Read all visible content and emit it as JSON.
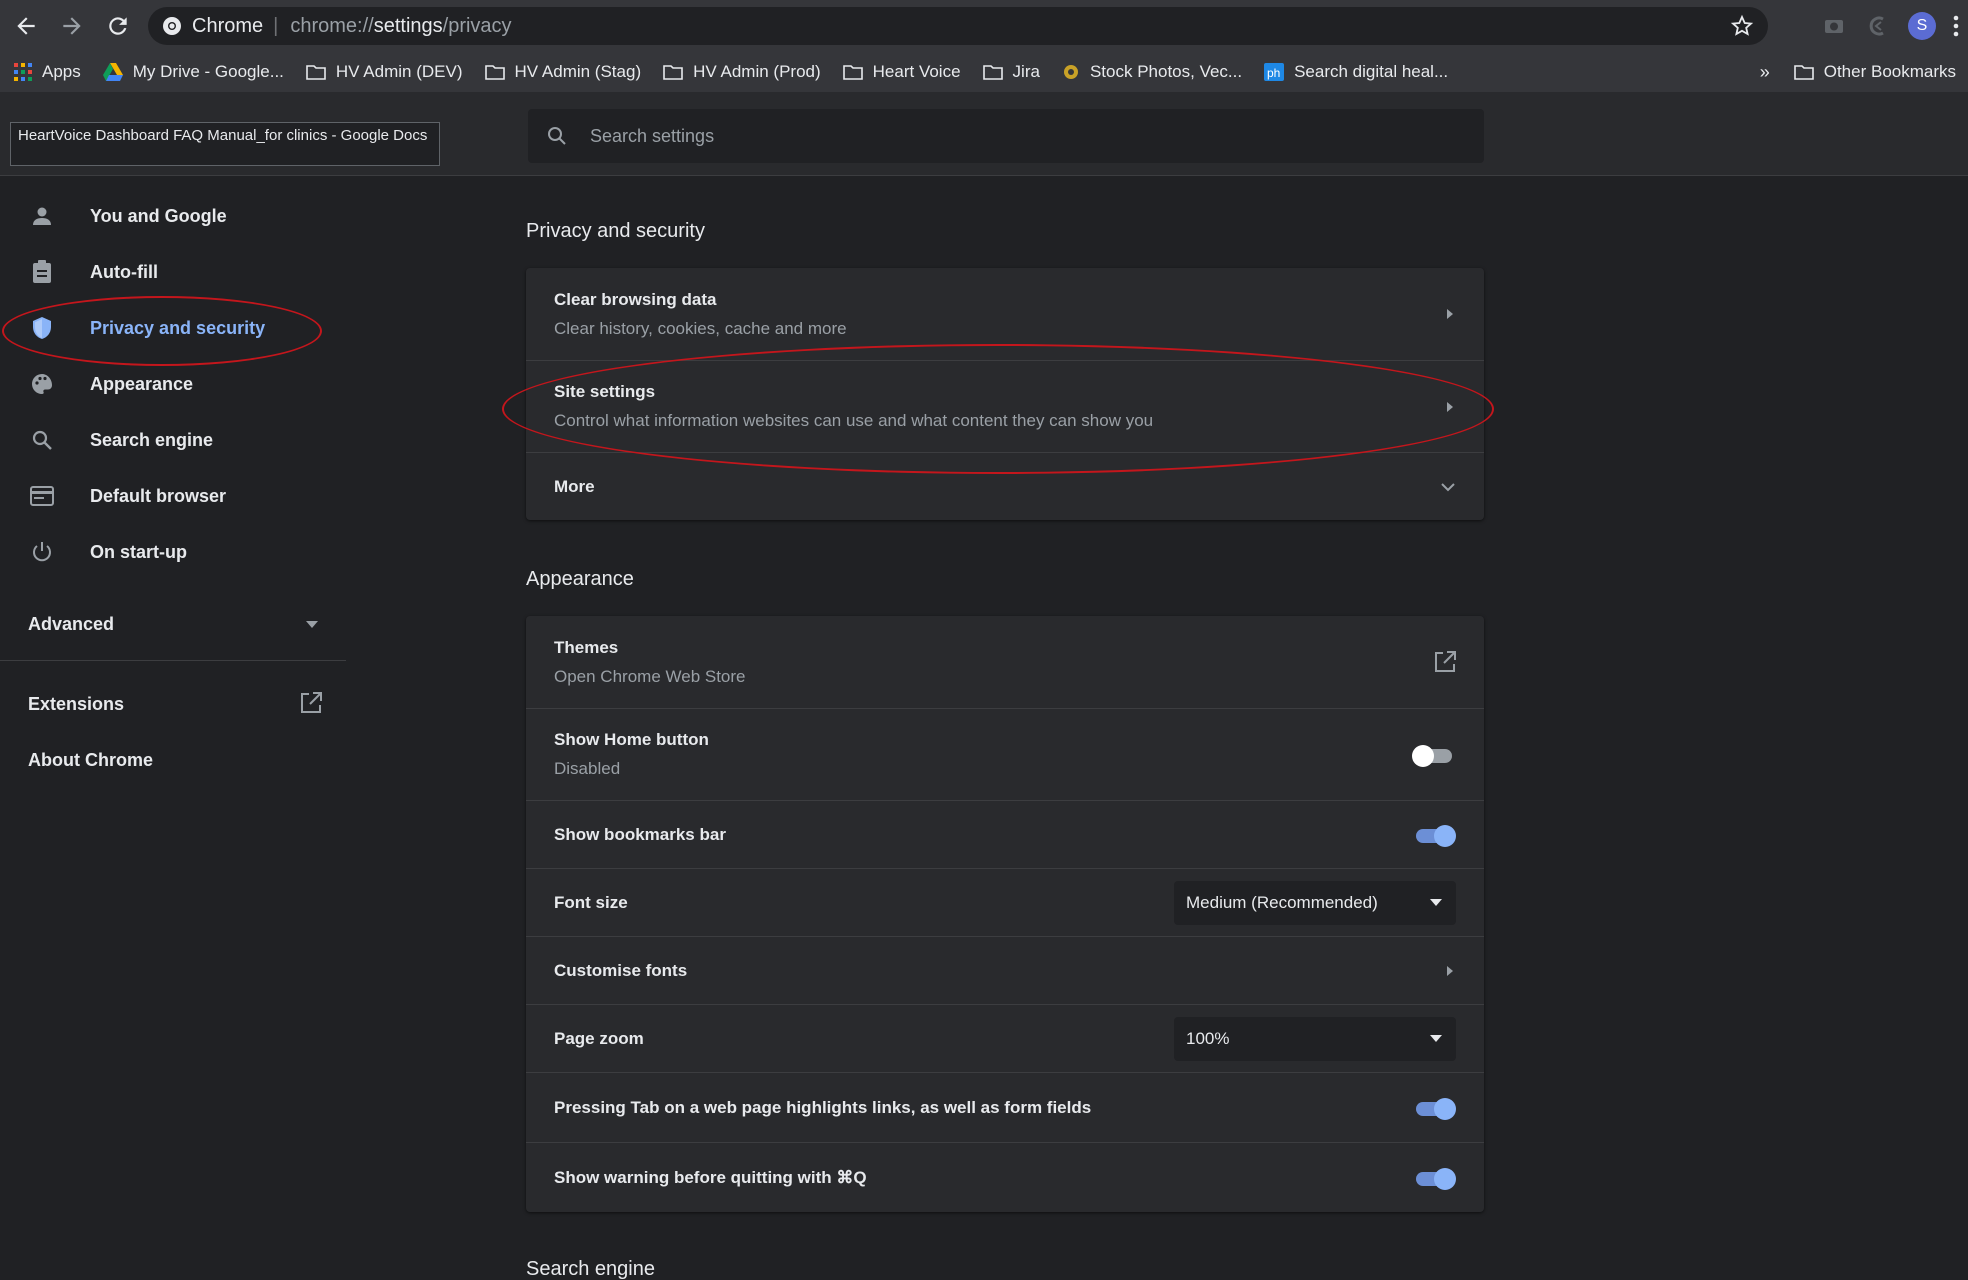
{
  "browser": {
    "site_chip": "Chrome",
    "url_scheme": "chrome://",
    "url_host": "settings",
    "url_path": "/privacy",
    "profile_initial": "S"
  },
  "bookmarks": [
    {
      "label": "Apps",
      "icon": "apps-grid-icon"
    },
    {
      "label": "My Drive - Google...",
      "icon": "google-drive-icon"
    },
    {
      "label": "HV Admin (DEV)",
      "icon": "folder-icon"
    },
    {
      "label": "HV Admin (Stag)",
      "icon": "folder-icon"
    },
    {
      "label": "HV Admin (Prod)",
      "icon": "folder-icon"
    },
    {
      "label": "Heart Voice",
      "icon": "folder-icon"
    },
    {
      "label": "Jira",
      "icon": "folder-icon"
    },
    {
      "label": "Stock Photos, Vec...",
      "icon": "stock-photos-icon"
    },
    {
      "label": "Search digital heal...",
      "icon": "ph-icon"
    }
  ],
  "bookmarks_overflow": "»",
  "other_bookmarks": "Other Bookmarks",
  "tooltip": "HeartVoice Dashboard FAQ Manual_for clinics - Google Docs",
  "search": {
    "placeholder": "Search settings"
  },
  "sidebar": {
    "items": [
      {
        "label": "You and Google",
        "icon": "person-icon"
      },
      {
        "label": "Auto-fill",
        "icon": "clipboard-icon"
      },
      {
        "label": "Privacy and security",
        "icon": "shield-icon",
        "active": true
      },
      {
        "label": "Appearance",
        "icon": "palette-icon"
      },
      {
        "label": "Search engine",
        "icon": "search-icon"
      },
      {
        "label": "Default browser",
        "icon": "browser-window-icon"
      },
      {
        "label": "On start-up",
        "icon": "power-icon"
      }
    ],
    "advanced": "Advanced",
    "extensions": "Extensions",
    "about": "About Chrome"
  },
  "privacy": {
    "title": "Privacy and security",
    "rows": [
      {
        "title": "Clear browsing data",
        "subtitle": "Clear history, cookies, cache and more"
      },
      {
        "title": "Site settings",
        "subtitle": "Control what information websites can use and what content they can show you"
      },
      {
        "title": "More"
      }
    ]
  },
  "appearance": {
    "title": "Appearance",
    "themes": {
      "title": "Themes",
      "subtitle": "Open Chrome Web Store"
    },
    "home_button": {
      "title": "Show Home button",
      "subtitle": "Disabled",
      "enabled": false
    },
    "bookmarks_bar": {
      "title": "Show bookmarks bar",
      "enabled": true
    },
    "font_size": {
      "title": "Font size",
      "value": "Medium (Recommended)"
    },
    "customise_fonts": {
      "title": "Customise fonts"
    },
    "page_zoom": {
      "title": "Page zoom",
      "value": "100%"
    },
    "tab_highlight": {
      "title": "Pressing Tab on a web page highlights links, as well as form fields",
      "enabled": true
    },
    "quit_warning": {
      "title": "Show warning before quitting with ⌘Q",
      "enabled": true
    }
  },
  "search_engine": {
    "title": "Search engine"
  },
  "colors": {
    "accent": "#8ab4f8",
    "background": "#202124",
    "card": "#292a2d",
    "annotation": "#c4161c"
  }
}
